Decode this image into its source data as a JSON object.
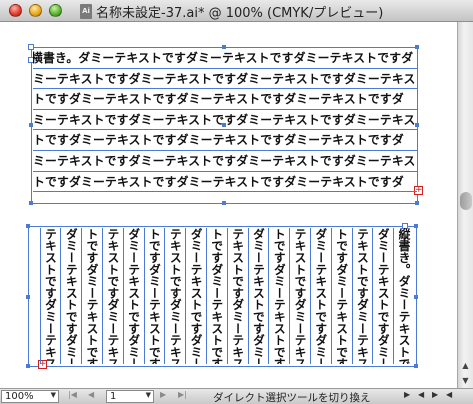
{
  "window": {
    "title": "名称未設定-37.ai* @ 100% (CMYK/プレビュー)",
    "doc_icon_label": "Ai"
  },
  "artwork": {
    "horizontal_lines": [
      "横書き。ダミーテキストですダミーテキストですダミーテキストですダ",
      "ミーテキストですダミーテキストですダミーテキストですダミーテキス",
      "トですダミーテキストですダミーテキストですダミーテキストですダ",
      "ミーテキストですダミーテキストですダミーテキストですダミーテキス",
      "トですダミーテキストですダミーテキストですダミーテキストですダ",
      "ミーテキストですダミーテキストですダミーテキストですダミーテキス",
      "トですダミーテキストですダミーテキストですダミーテキストですダ"
    ],
    "vertical_lines": [
      "縦書き。ダミーテキストです",
      "ダミーテキストですダミー",
      "テキストですダミーテキス",
      "トですダミーテキストです",
      "ダミーテキストですダミー",
      "テキストですダミーテキス",
      "トですダミーテキストです",
      "ダミーテキストですダミー",
      "テキストですダミーテキス",
      "トですダミーテキストです",
      "ダミーテキストですダミー",
      "テキストですダミーテキス",
      "トですダミーテキストです",
      "ダミーテキストですダミー",
      "テキストですダミーテキス",
      "トですダミーテキストです",
      "ダミーテキストですダミー",
      "テキストですダミーテキス"
    ],
    "overflow_symbol": "+"
  },
  "statusbar": {
    "zoom": "100%",
    "page": "1",
    "message": "ダイレクト選択ツールを切り換え"
  },
  "colors": {
    "selection": "#4b7bd4",
    "overflow": "#d02020"
  }
}
